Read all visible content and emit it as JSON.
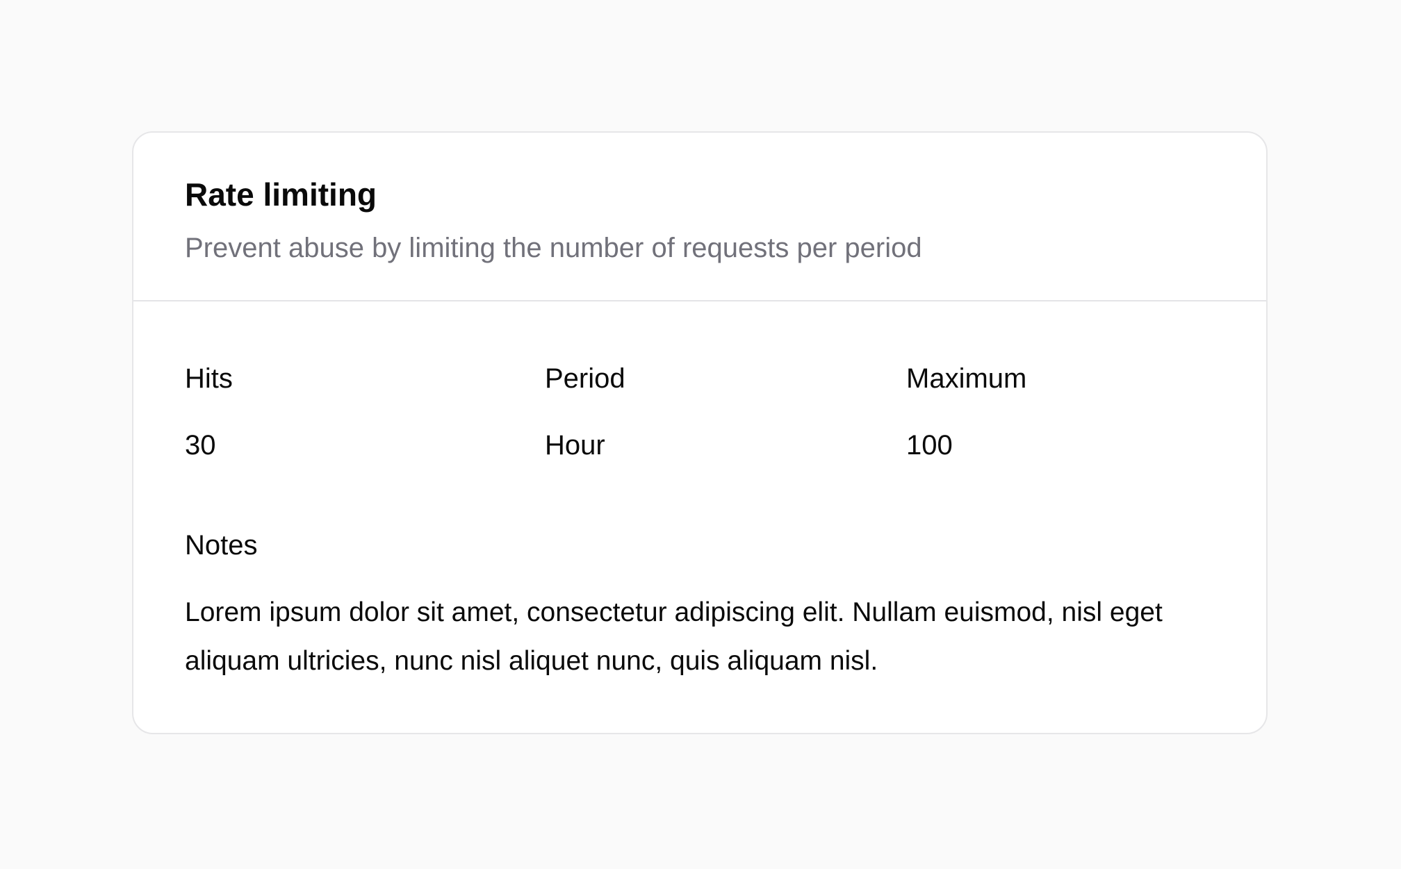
{
  "card": {
    "title": "Rate limiting",
    "subtitle": "Prevent abuse by limiting the number of requests per period",
    "fields": [
      {
        "label": "Hits",
        "value": "30"
      },
      {
        "label": "Period",
        "value": "Hour"
      },
      {
        "label": "Maximum",
        "value": "100"
      }
    ],
    "notes_label": "Notes",
    "notes": "Lorem ipsum dolor sit amet, consectetur adipiscing elit. Nullam euismod, nisl eget aliquam ultricies, nunc nisl aliquet nunc, quis aliquam nisl."
  }
}
